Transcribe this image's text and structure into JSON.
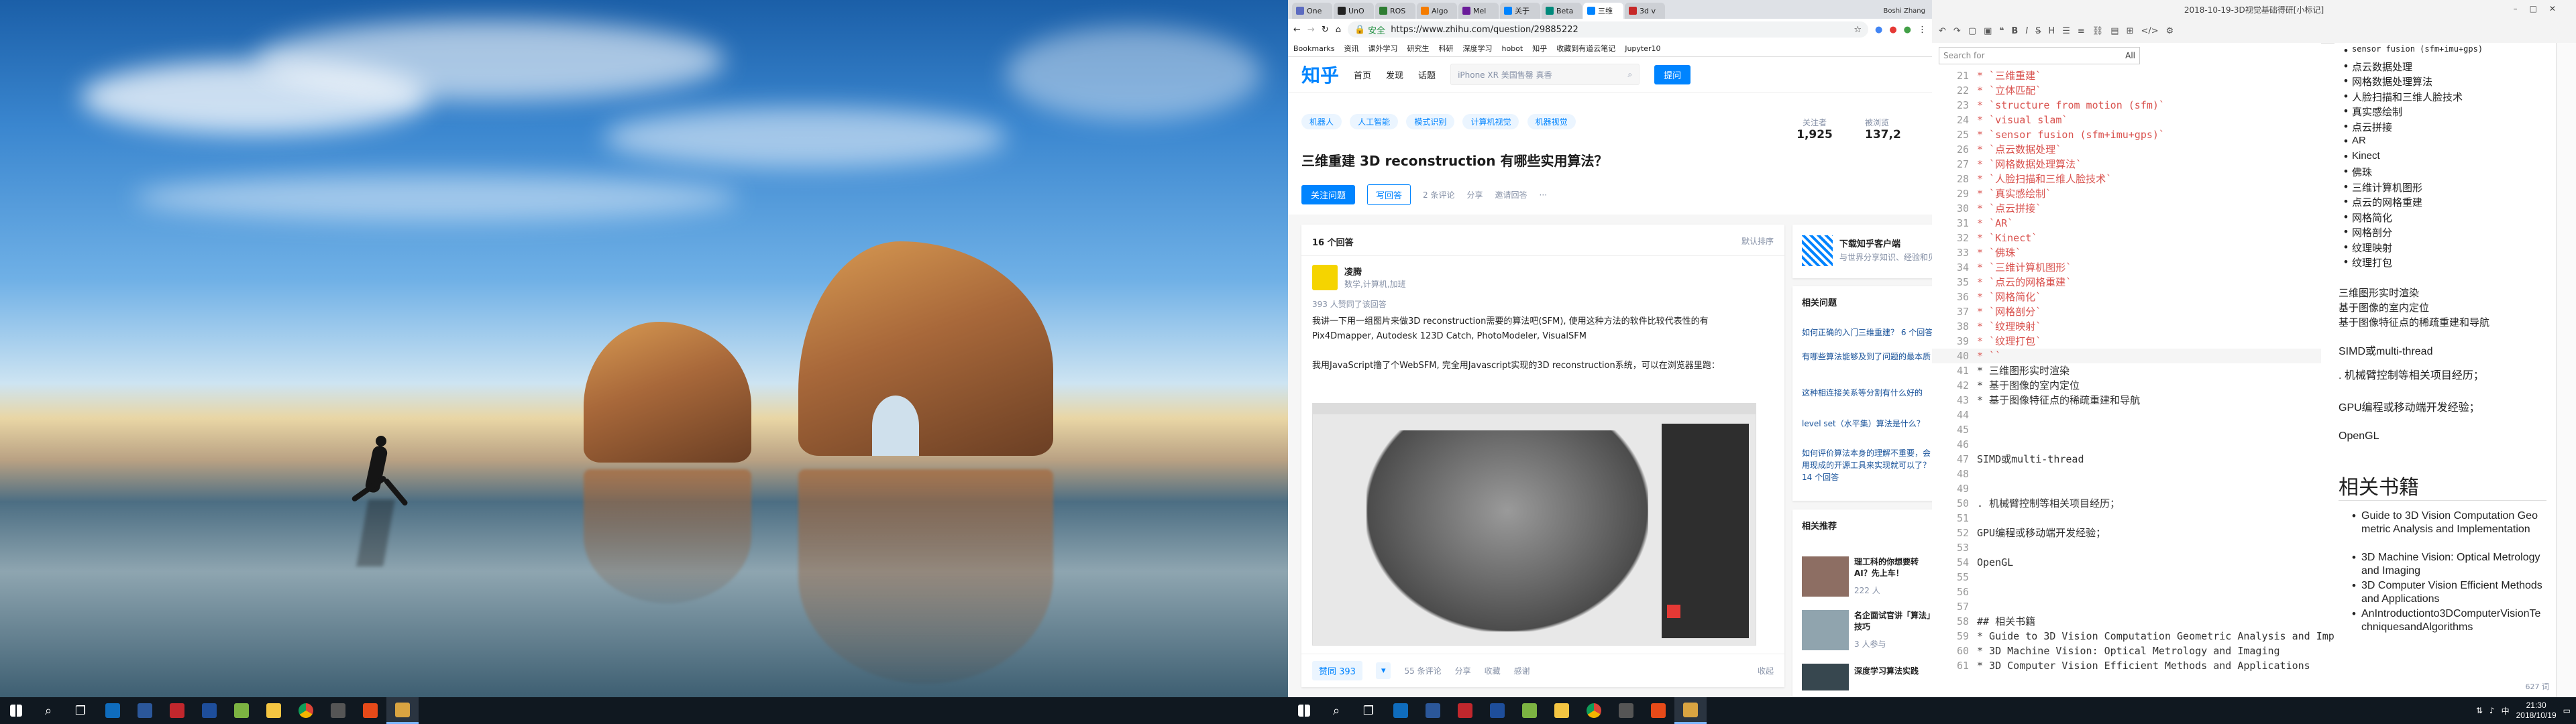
{
  "left_taskbar": {
    "icons": [
      "start-icon",
      "search-icon",
      "task-view-icon",
      "outlook-icon",
      "app-icon",
      "app-icon",
      "word-icon",
      "notes-icon",
      "folder-icon",
      "chrome-icon",
      "app-icon",
      "app-icon",
      "typora-icon"
    ]
  },
  "chrome": {
    "tabs": [
      {
        "label": "One"
      },
      {
        "label": "UnO"
      },
      {
        "label": "ROS"
      },
      {
        "label": "Algo"
      },
      {
        "label": "Mel"
      },
      {
        "label": "关于"
      },
      {
        "label": "Beta"
      },
      {
        "label": "三维"
      },
      {
        "label": "3d v"
      }
    ],
    "user_badge": "Boshi Zhang",
    "address_secure": "安全",
    "address_url": "https://www.zhihu.com/question/29885222",
    "bookmarks": [
      "Bookmarks",
      "资讯",
      "课外学习",
      "研究生",
      "科研",
      "深度学习",
      "hobot",
      "知乎",
      "收藏到有道云笔记",
      "Jupyter10"
    ]
  },
  "zhihu": {
    "logo": "知乎",
    "nav": [
      "首页",
      "发现",
      "话题"
    ],
    "search_placeholder": "iPhone XR 美国售罄 真香",
    "ask_button": "提问",
    "topics": [
      "机器人",
      "人工智能",
      "模式识别",
      "计算机视觉",
      "机器视觉"
    ],
    "question_title": "三维重建 3D reconstruction 有哪些实用算法？",
    "follow_button": "关注问题",
    "answer_button": "写回答",
    "comments": "2 条评论",
    "share": "分享",
    "invite": "邀请回答",
    "followers_label": "关注者",
    "followers_count": "1,925",
    "views_label": "被浏览",
    "views_count": "137,2",
    "answers_count": "16 个回答",
    "sort": "默认排序",
    "author_name": "凌腾",
    "author_bio": "数学,计算机,加班",
    "upvote_info": "393 人赞同了该回答",
    "answer_p1": "我讲一下用一组图片来做3D reconstruction需要的算法吧(SFM), 使用这种方法的软件比较代表性的有 Pix4Dmapper, Autodesk 123D Catch, PhotoModeler, VisualSFM",
    "answer_p2": "我用JavaScript撸了个WebSFM, 完全用Javascript实现的3D reconstruction系统，可以在浏览器里跑：",
    "vote_button": "赞同 393",
    "answer_comments": "55 条评论",
    "answer_share": "分享",
    "collect": "收藏",
    "thanks": "感谢",
    "fold": "收起",
    "app_promo_title": "下载知乎客户端",
    "app_promo_sub": "与世界分享知识、经验和见解",
    "related_title": "相关问题",
    "related": [
      "如何正确的入门三维重建？ 6 个回答",
      "有哪些算法能够及到了问题的最本质",
      "这种相连接关系等分割有什么好的",
      "level set（水平集）算法是什么？",
      "如何评价算法本身的理解不重要，会用现成的开源工具来实现就可以了？ 14 个回答"
    ],
    "recommend_title": "相关推荐",
    "recommend": [
      {
        "title": "理工科的你想要转AI？先上车！",
        "meta": "222 人"
      },
      {
        "title": "名企面试官讲「算法」技巧",
        "meta": "3 人参与"
      },
      {
        "title": "深度学习算法实践",
        "meta": ""
      }
    ]
  },
  "typora": {
    "title": "2018-10-19-3D视觉基础得研[小标记]",
    "find_placeholder": "Search for",
    "find_all": "All",
    "code_lines": [
      {
        "n": "21",
        "t": "* `三维重建`"
      },
      {
        "n": "22",
        "t": "* `立体匹配`"
      },
      {
        "n": "23",
        "t": "* `structure from motion (sfm)`"
      },
      {
        "n": "24",
        "t": "* `visual slam`"
      },
      {
        "n": "25",
        "t": "* `sensor fusion (sfm+imu+gps)`"
      },
      {
        "n": "26",
        "t": "* `点云数据处理`"
      },
      {
        "n": "27",
        "t": "* `网格数据处理算法`"
      },
      {
        "n": "28",
        "t": "* `人脸扫描和三维人脸技术`"
      },
      {
        "n": "29",
        "t": "* `真实感绘制`"
      },
      {
        "n": "30",
        "t": "* `点云拼接`"
      },
      {
        "n": "31",
        "t": "* `AR`"
      },
      {
        "n": "32",
        "t": "* `Kinect`"
      },
      {
        "n": "33",
        "t": "* `佛珠`"
      },
      {
        "n": "34",
        "t": "* `三维计算机图形`"
      },
      {
        "n": "35",
        "t": "* `点云的网格重建`"
      },
      {
        "n": "36",
        "t": "* `网格简化`"
      },
      {
        "n": "37",
        "t": "* `网格剖分`"
      },
      {
        "n": "38",
        "t": "* `纹理映射`"
      },
      {
        "n": "39",
        "t": "* `纹理打包`"
      },
      {
        "n": "40",
        "t": "* ``"
      },
      {
        "n": "41",
        "t": "* 三维图形实时渲染"
      },
      {
        "n": "42",
        "t": "* 基于图像的室内定位"
      },
      {
        "n": "43",
        "t": "* 基于图像特征点的稀疏重建和导航"
      },
      {
        "n": "44",
        "t": ""
      },
      {
        "n": "45",
        "t": ""
      },
      {
        "n": "46",
        "t": ""
      },
      {
        "n": "47",
        "t": "SIMD或multi-thread"
      },
      {
        "n": "48",
        "t": ""
      },
      {
        "n": "49",
        "t": ""
      },
      {
        "n": "50",
        "t": ". 机械臂控制等相关项目经历；"
      },
      {
        "n": "51",
        "t": ""
      },
      {
        "n": "52",
        "t": "GPU编程或移动端开发经验；"
      },
      {
        "n": "53",
        "t": ""
      },
      {
        "n": "54",
        "t": "OpenGL"
      },
      {
        "n": "55",
        "t": ""
      },
      {
        "n": "56",
        "t": ""
      },
      {
        "n": "57",
        "t": ""
      },
      {
        "n": "58",
        "t": "## 相关书籍"
      },
      {
        "n": "59",
        "t": "* Guide to 3D Vision Computation Geometric Analysis and Implementation"
      },
      {
        "n": "60",
        "t": "* 3D Machine Vision: Optical Metrology and Imaging"
      },
      {
        "n": "61",
        "t": "* 3D Computer Vision Efficient Methods and Applications"
      }
    ],
    "preview_bullets": [
      "sensor fusion (sfm+imu+gps)",
      "点云数据处理",
      "网格数据处理算法",
      "人脸扫描和三维人脸技术",
      "真实感绘制",
      "点云拼接",
      "AR",
      "Kinect",
      "佛珠",
      "三维计算机图形",
      "点云的网格重建",
      "网格简化",
      "网格剖分",
      "纹理映射",
      "纹理打包"
    ],
    "preview_bullets2": [
      "三维图形实时渲染",
      "基于图像的室内定位",
      "基于图像特征点的稀疏重建和导航"
    ],
    "preview_simd": "SIMD或multi-thread",
    "preview_robot": ". 机械臂控制等相关项目经历；",
    "preview_gpu": "GPU编程或移动端开发经验；",
    "preview_opengl": "OpenGL",
    "preview_heading": "相关书籍",
    "preview_books": [
      "Guide to 3D Vision Computation Geometric Analysis and Implementation",
      "3D Machine Vision: Optical Metrology and Imaging",
      "3D Computer Vision Efficient Methods and Applications",
      "AnIntroductionto3DComputerVisionTechniquesandAlgorithms"
    ],
    "word_count": "627 词"
  },
  "right_taskbar": {
    "time": "21:30",
    "date": "2018/10/19"
  }
}
